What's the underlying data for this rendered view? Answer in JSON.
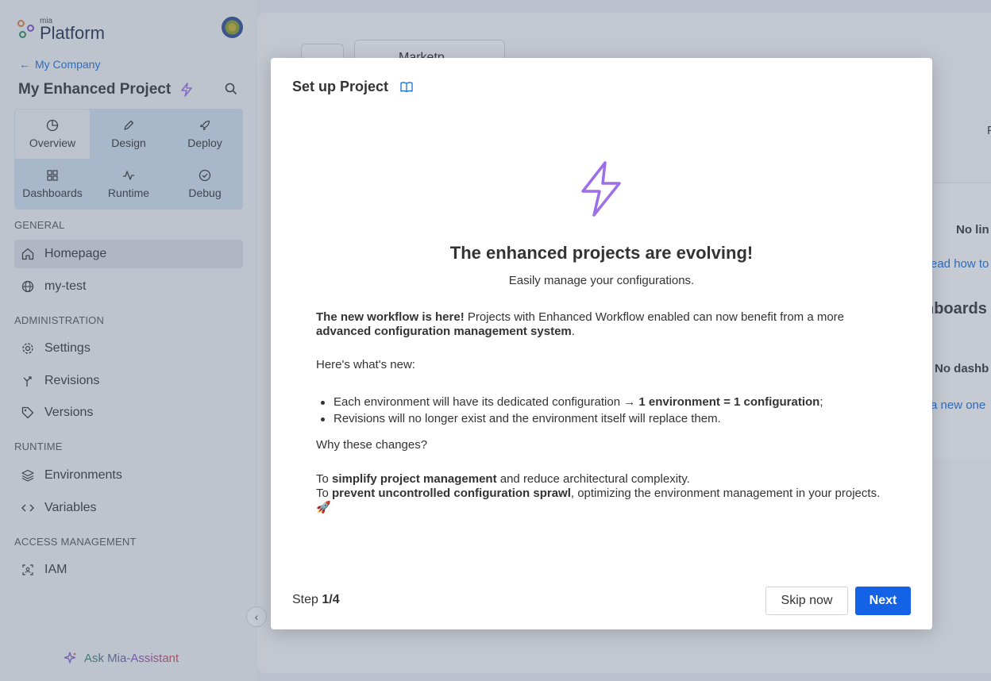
{
  "brand": {
    "small": "mia",
    "big": "Platform"
  },
  "sidebar": {
    "back_link": "My Company",
    "project_title": "My Enhanced Project",
    "nav": [
      {
        "label": "Overview",
        "icon": "chart-pie-icon"
      },
      {
        "label": "Design",
        "icon": "pencil-icon"
      },
      {
        "label": "Deploy",
        "icon": "rocket-icon"
      },
      {
        "label": "Dashboards",
        "icon": "grid-icon"
      },
      {
        "label": "Runtime",
        "icon": "activity-icon"
      },
      {
        "label": "Debug",
        "icon": "check-circle-icon"
      }
    ],
    "sections": {
      "general": "GENERAL",
      "administration": "ADMINISTRATION",
      "runtime": "RUNTIME",
      "access": "ACCESS MANAGEMENT"
    },
    "items": {
      "homepage": "Homepage",
      "my_test": "my-test",
      "settings": "Settings",
      "revisions": "Revisions",
      "versions": "Versions",
      "environments": "Environments",
      "variables": "Variables",
      "iam": "IAM"
    },
    "assistant": "Ask Mia-Assistant"
  },
  "main": {
    "tab_plus": "+",
    "tab_market": "Marketp...",
    "tab_dots": "⋮",
    "peek": {
      "p1": "F",
      "no_links": "No lin",
      "read_how": "ead how to",
      "dashboards": "nboards",
      "no_dash": "No dashb",
      "new_one": "a new one"
    }
  },
  "modal": {
    "title": "Set up Project",
    "headline": "The enhanced projects are evolving!",
    "subline": "Easily manage your configurations.",
    "p1_bold": "The new workflow is here!",
    "p1_text": " Projects with Enhanced Workflow enabled can now benefit from a more ",
    "p1_bold2": "advanced configuration management system",
    "p1_end": ".",
    "whats_new": "Here's what's new:",
    "bullet1_text": "Each environment will have its dedicated configuration → ",
    "bullet1_bold": "1 environment = 1 configuration",
    "bullet1_end": ";",
    "bullet2": "Revisions will no longer exist and the environment itself will replace them.",
    "why": "Why these changes?",
    "r1_pre": "To ",
    "r1_bold": "simplify project management",
    "r1_text": " and reduce architectural complexity.",
    "r2_pre": "To ",
    "r2_bold": "prevent uncontrolled configuration sprawl",
    "r2_text": ", optimizing the environment management in your projects. 🚀",
    "step_label": "Step ",
    "step_value": "1/4",
    "skip": "Skip now",
    "next": "Next"
  },
  "colors": {
    "accent": "#1462e6",
    "link": "#1a6fd8",
    "bolt": "#9c6ee8"
  }
}
